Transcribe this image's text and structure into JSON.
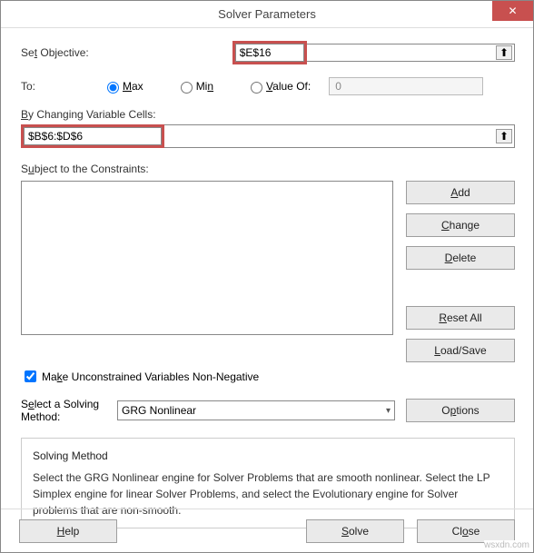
{
  "window": {
    "title": "Solver Parameters",
    "close": "✕"
  },
  "objective": {
    "label_pre": "Se",
    "label_u": "t",
    "label_post": " Objective:",
    "value": "$E$16"
  },
  "to": {
    "label": "To:",
    "max_u": "M",
    "max_post": "ax",
    "min_pre": "Mi",
    "min_u": "n",
    "value_u": "V",
    "value_post": "alue Of:",
    "value_input": "0"
  },
  "cells": {
    "label_u": "B",
    "label_post": "y Changing Variable Cells:",
    "value": "$B$6:$D$6"
  },
  "constraints": {
    "label_pre": "S",
    "label_u": "u",
    "label_post": "bject to the Constraints:"
  },
  "buttons": {
    "add_u": "A",
    "add_post": "dd",
    "change_u": "C",
    "change_post": "hange",
    "delete_u": "D",
    "delete_post": "elete",
    "reset_u": "R",
    "reset_post": "eset All",
    "load_u": "L",
    "load_post": "oad/Save",
    "options_pre": "O",
    "options_u": "p",
    "options_post": "tions"
  },
  "checkbox": {
    "label_pre": "Ma",
    "label_u": "k",
    "label_post": "e Unconstrained Variables Non-Negative"
  },
  "method": {
    "label_pre": "S",
    "label_u": "e",
    "label_post": "lect a Solving",
    "label2": "Method:",
    "value": "GRG Nonlinear"
  },
  "info": {
    "title": "Solving Method",
    "body": "Select the GRG Nonlinear engine for Solver Problems that are smooth nonlinear. Select the LP Simplex engine for linear Solver Problems, and select the Evolutionary engine for Solver problems that are non-smooth."
  },
  "footer": {
    "help_u": "H",
    "help_post": "elp",
    "solve_u": "S",
    "solve_post": "olve",
    "close_pre": "Cl",
    "close_u": "o",
    "close_post": "se"
  },
  "watermark": "wsxdn.com",
  "ref_icon": "⬆"
}
